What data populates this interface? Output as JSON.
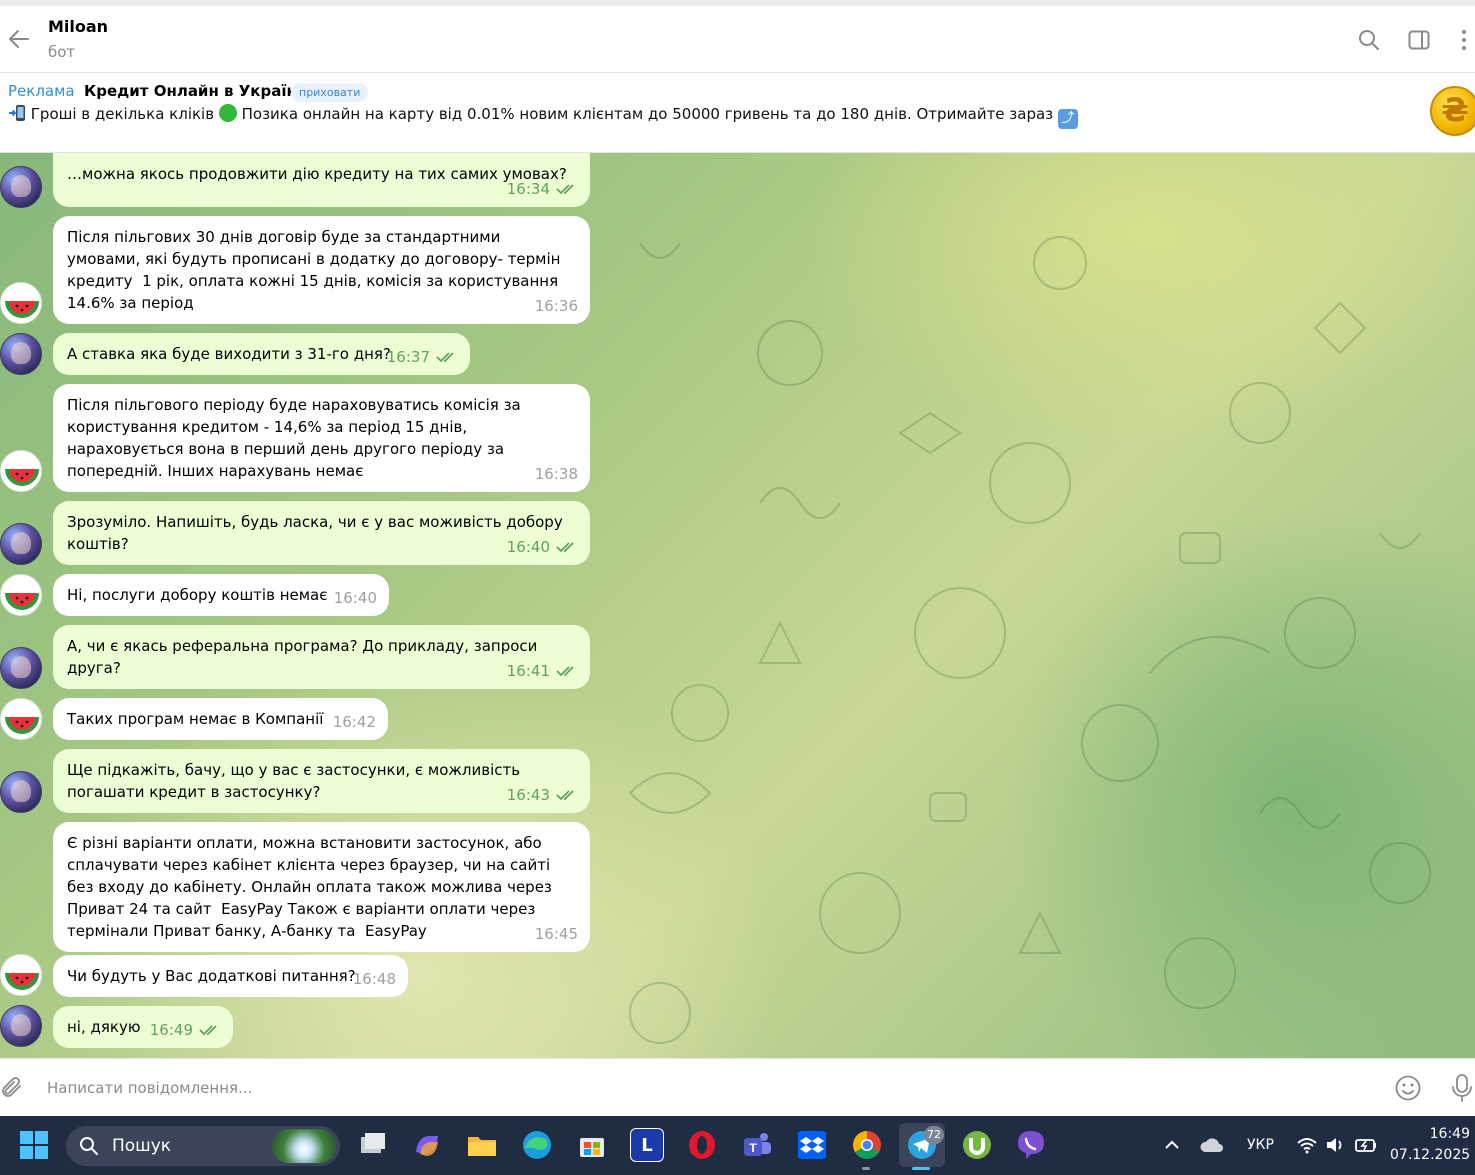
{
  "header": {
    "title": "Miloan",
    "subtitle": "бот"
  },
  "ad": {
    "label": "Реклама",
    "title": "Кредит Онлайн в Україні",
    "hide": "приховати",
    "text": "Гроші в декілька кліків",
    "text2": "Позика онлайн на карту від 0.01% новим клієнтам до 50000 гривень та до 180 днів. Отримайте зараз",
    "logo_char": "₴"
  },
  "messages": [
    {
      "side": "out",
      "text": "…можна якось продовжити дію кредиту на тих самих умовах?",
      "time": "16:34"
    },
    {
      "side": "in",
      "text": "Після пільгових 30 днів договір буде за стандартними умовами, які будуть прописані в додатку до договору- термін кредиту  1 рік, оплата кожні 15 днів, комісія за користування 14.6% за період",
      "time": "16:36"
    },
    {
      "side": "out",
      "text": "А ставка яка буде виходити з 31-го дня?",
      "time": "16:37"
    },
    {
      "side": "in",
      "text": "Після пільгового періоду буде нараховуватись комісія за користування кредитом - 14,6% за період 15 днів, нараховується вона в перший день другого періоду за попередній. Інших нарахувань немає",
      "time": "16:38"
    },
    {
      "side": "out",
      "text": "Зрозуміло. Напишіть, будь ласка, чи є у вас моживість добору коштів?",
      "time": "16:40"
    },
    {
      "side": "in",
      "text": "Ні, послуги добору коштів немає",
      "time": "16:40"
    },
    {
      "side": "out",
      "text": "А, чи є якась реферальна програма? До прикладу, запроси друга?",
      "time": "16:41"
    },
    {
      "side": "in",
      "text": "Таких програм немає в Компанії",
      "time": "16:42"
    },
    {
      "side": "out",
      "text": "Ще підкажіть, бачу, що у вас є застосунки, є можливість погашати кредит в застосунку?",
      "time": "16:43"
    },
    {
      "side": "in",
      "text": "Є різні варіанти оплати, можна встановити застосунок, або сплачувати через кабінет клієнта через браузер, чи на сайті без входу до кабінету. Онлайн оплата також можлива через Приват 24 та сайт  EasyPay Також є варіанти оплати через термінали Приват банку, А-банку та  EasyPay",
      "time": "16:45"
    },
    {
      "side": "in",
      "text": "Чи будуть у Вас додаткові питання?",
      "time": "16:48"
    },
    {
      "side": "out",
      "text": "ні, дякую",
      "time": "16:49"
    }
  ],
  "input": {
    "placeholder": "Написати повідомлення..."
  },
  "taskbar": {
    "search_label": "Пошук",
    "telegram_badge": "72",
    "language": "УКР",
    "time": "16:49",
    "date": "07.12.2025",
    "apps": [
      "file-explorer-app",
      "copilot-app",
      "folder-app",
      "edge-app",
      "store-app",
      "lastpass-app",
      "opera-app",
      "teams-app",
      "dropbox-app",
      "chrome-app",
      "telegram-app",
      "utorrent-app",
      "viber-app"
    ],
    "lastpass_letter": "L"
  },
  "colors": {
    "outgoing_bubble": "#eefed4",
    "incoming_bubble": "#ffffff",
    "outgoing_meta": "#5fa25f",
    "ad_label": "#2f8fd6",
    "taskbar_bg": "#1f2c42"
  }
}
